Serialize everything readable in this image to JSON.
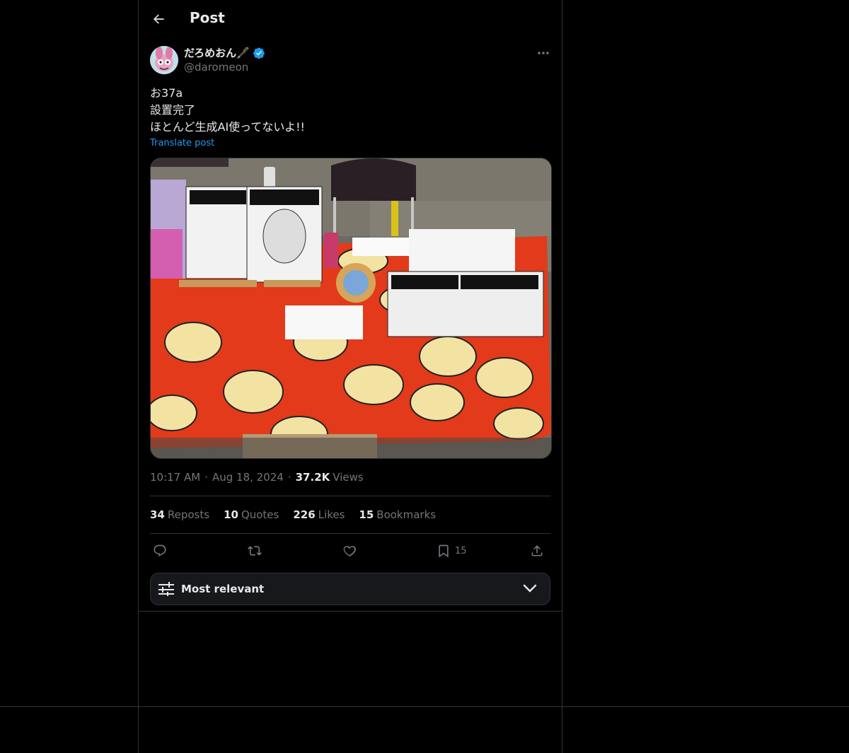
{
  "header": {
    "title": "Post"
  },
  "author": {
    "display_name": "だろめおん🖋️",
    "handle": "@daromeon",
    "verified": true
  },
  "post": {
    "lines": [
      "お37a",
      "設置完了",
      "ほとんど生成AI使ってないよ!!"
    ],
    "translate_label": "Translate post"
  },
  "meta": {
    "time": "10:17 AM",
    "date": "Aug 18, 2024",
    "views_count": "37.2K",
    "views_label": "Views",
    "separator": "·"
  },
  "stats": {
    "reposts": {
      "count": "34",
      "label": "Reposts"
    },
    "quotes": {
      "count": "10",
      "label": "Quotes"
    },
    "likes": {
      "count": "226",
      "label": "Likes"
    },
    "bookmarks": {
      "count": "15",
      "label": "Bookmarks"
    }
  },
  "actions": {
    "bookmark_count": "15",
    "icons": [
      "reply-icon",
      "repost-icon",
      "like-icon",
      "bookmark-icon",
      "share-icon"
    ]
  },
  "sort": {
    "label": "Most relevant"
  },
  "colors": {
    "background": "#000000",
    "border": "#2f3336",
    "text": "#e7e9ea",
    "muted": "#71767b",
    "accent": "#1d9bf0"
  }
}
